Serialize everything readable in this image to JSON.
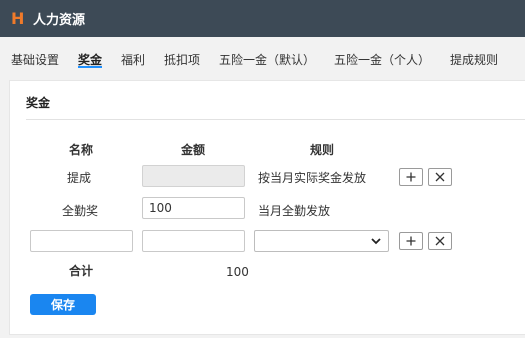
{
  "app": {
    "logo": "H",
    "title": "人力资源"
  },
  "tabs": [
    {
      "label": "基础设置"
    },
    {
      "label": "奖金",
      "active": true
    },
    {
      "label": "福利"
    },
    {
      "label": "抵扣项"
    },
    {
      "label": "五险一金（默认）"
    },
    {
      "label": "五险一金（个人）"
    },
    {
      "label": "提成规则"
    }
  ],
  "panel": {
    "title": "奖金",
    "columns": {
      "name": "名称",
      "amount": "金额",
      "rule": "规则"
    },
    "rows": [
      {
        "name": "提成",
        "amount": "",
        "rule": "按当月实际奖金发放",
        "amount_disabled": true
      },
      {
        "name": "全勤奖",
        "amount": "100",
        "rule": "当月全勤发放"
      }
    ],
    "new_row": {
      "name": "",
      "amount": "",
      "rule_selected": ""
    },
    "total": {
      "label": "合计",
      "value": "100"
    },
    "save_label": "保存"
  },
  "colors": {
    "accent": "#1a86f0",
    "topbar": "#3d4a56",
    "logo": "#f07a2a"
  }
}
